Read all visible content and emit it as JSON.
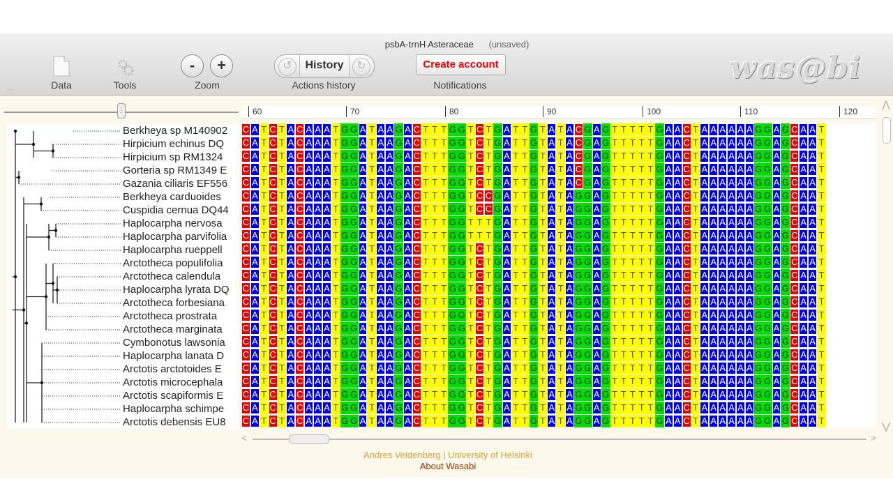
{
  "window": {
    "title": "psbA-trnH Asteraceae",
    "status": "(unsaved)"
  },
  "toolbar": {
    "data_label": "Data",
    "tools_label": "Tools",
    "zoom_label": "Zoom",
    "zoom_out": "-",
    "zoom_in": "+",
    "history_label": "History",
    "actions_history_label": "Actions history",
    "create_account_label": "Create account",
    "notifications_label": "Notifications",
    "logo_text": "was@bi",
    "accent_color": "#e00000"
  },
  "ruler": {
    "ticks": [
      "60",
      "70",
      "80",
      "90",
      "100",
      "110",
      "120"
    ]
  },
  "taxa": [
    {
      "name": "Berkheya sp M140902"
    },
    {
      "name": "Hirpicium echinus DQ"
    },
    {
      "name": "Hirpicium sp RM1324"
    },
    {
      "name": "Gorteria sp RM1349 E"
    },
    {
      "name": "Gazania ciliaris EF556"
    },
    {
      "name": "Berkheya carduoides"
    },
    {
      "name": "Cuspidia cernua DQ44"
    },
    {
      "name": "Haplocarpha nervosa"
    },
    {
      "name": "Haplocarpha parvifolia"
    },
    {
      "name": "Haplocarpha rueppell"
    },
    {
      "name": "Arctotheca populifolia"
    },
    {
      "name": "Arctotheca calendula"
    },
    {
      "name": "Haplocarpha lyrata DQ"
    },
    {
      "name": "Arctotheca forbesiana"
    },
    {
      "name": "Arctotheca prostrata"
    },
    {
      "name": "Arctotheca marginata"
    },
    {
      "name": "Cymbonotus lawsonia"
    },
    {
      "name": "Haplocarpha lanata D"
    },
    {
      "name": "Arctotis arctotoides E"
    },
    {
      "name": "Arctotis microcephala"
    },
    {
      "name": "Arctotis scapiformis E"
    },
    {
      "name": "Haplocarpha schimpe"
    },
    {
      "name": "Arctotis debensis EU8"
    }
  ],
  "alignment": {
    "base_colors": {
      "A": "#0000e6",
      "T": "#ffff00",
      "G": "#00dd00",
      "C": "#e60000"
    },
    "consensus": "CATCTACAAATGGATAAGACTTTGGTCTGATTGTATAGGAGTTTTTGAACTAAAAAAGGAGCAAT",
    "row_overrides": {
      "0": {
        "37": "C"
      },
      "1": {
        "37": "C"
      },
      "2": {
        "37": "C"
      },
      "3": {
        "37": "C"
      },
      "4": {
        "37": "C"
      },
      "5": {
        "27": "C"
      },
      "6": {
        "27": "C"
      },
      "7": {
        "26": "T"
      },
      "8": {
        "26": "T"
      }
    }
  },
  "footer": {
    "author": "Andres Veidenberg",
    "separator": "|",
    "university": "University of Helsinki",
    "about": "About Wasabi"
  }
}
